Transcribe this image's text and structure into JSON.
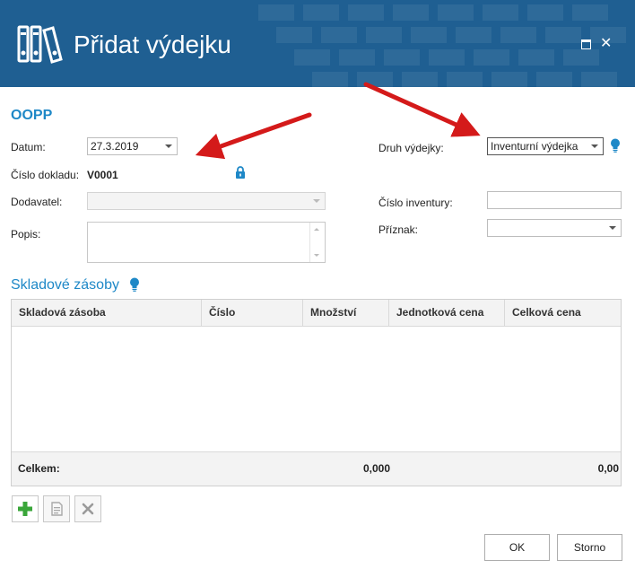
{
  "window": {
    "title": "Přidat výdejku",
    "maximize_icon": "maximize-icon",
    "close_icon": "close-icon",
    "close_glyph": "✕"
  },
  "form": {
    "section_title": "OOPP",
    "datum": {
      "label": "Datum:",
      "value": "27.3.2019"
    },
    "cislo_dokladu": {
      "label": "Číslo dokladu:",
      "value": "V0001"
    },
    "dodavatel": {
      "label": "Dodavatel:",
      "value": ""
    },
    "popis": {
      "label": "Popis:",
      "value": ""
    },
    "druh_vydejky": {
      "label": "Druh výdejky:",
      "value": "Inventurní výdejka"
    },
    "cislo_inventury": {
      "label": "Číslo inventury:",
      "value": ""
    },
    "priznak": {
      "label": "Příznak:",
      "value": ""
    }
  },
  "stock": {
    "section_title": "Skladové zásoby",
    "columns": [
      "Skladová zásoba",
      "Číslo",
      "Množství",
      "Jednotková cena",
      "Celková cena"
    ],
    "rows": [],
    "footer": {
      "label": "Celkem:",
      "quantity_total": "0,000",
      "price_total": "0,00"
    }
  },
  "toolbar": {
    "add_icon": "plus-icon",
    "edit_icon": "edit-document-icon",
    "delete_icon": "delete-x-icon"
  },
  "buttons": {
    "ok": "OK",
    "cancel": "Storno"
  },
  "colors": {
    "header_bg": "#1f5f92",
    "accent": "#1e88c7",
    "annotation_arrow": "#d41a1a",
    "add_green": "#3aa63a"
  }
}
